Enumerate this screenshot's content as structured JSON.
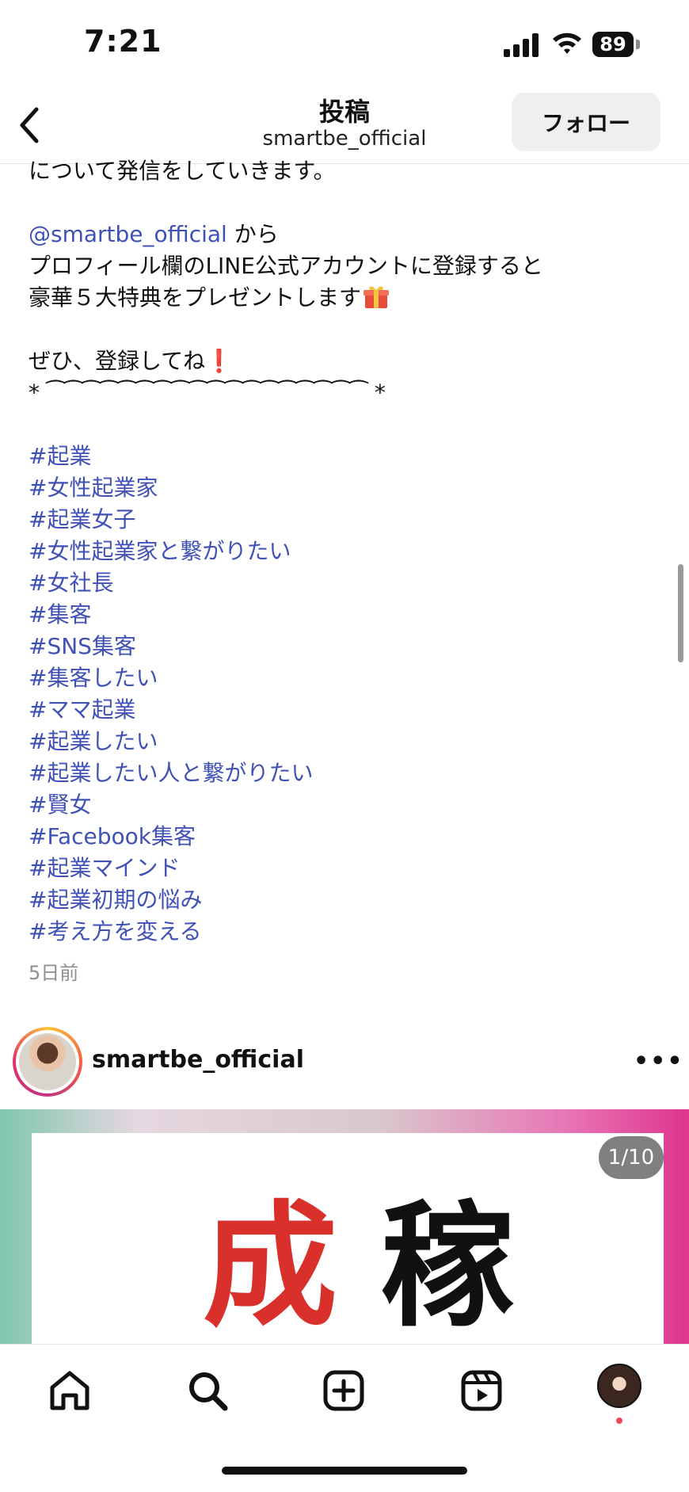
{
  "status": {
    "time": "7:21",
    "battery": "89"
  },
  "header": {
    "title": "投稿",
    "subtitle": "smartbe_official",
    "follow_label": "フォロー"
  },
  "caption": {
    "lines": [
      "について発信をしていきます。",
      "",
      "@smartbe_official",
      "プロフィール欄のLINE公式アカウントに登録すると",
      "豪華５大特典をプレゼントします",
      "",
      "ぜひ、登録してね",
      "* ⁀⁀⁀⁀⁀⁀⁀⁀⁀⁀⁀⁀⁀⁀⁀⁀⁀⁀ *"
    ],
    "mention": "@smartbe_official",
    "mention_suffix": " から",
    "hashtags": [
      "#起業",
      "#女性起業家",
      "#起業女子",
      "#女性起業家と繋がりたい",
      "#女社長",
      "#集客",
      "#SNS集客",
      "#集客したい",
      "#ママ起業",
      "#起業したい",
      "#起業したい人と繋がりたい",
      "#賢女",
      "#Facebook集客",
      "#起業マインド",
      "#起業初期の悩み",
      "#考え方を変える"
    ],
    "time_ago": "5日前"
  },
  "post": {
    "username": "smartbe_official",
    "more": "•••",
    "counter": "1/10",
    "image_text_red": "成",
    "image_text_black": "稼"
  },
  "nav": {
    "items": [
      "home-icon",
      "search-icon",
      "create-icon",
      "reels-icon",
      "profile-avatar"
    ]
  },
  "colors": {
    "link": "#3f51b5",
    "accent_red": "#d9302b"
  }
}
